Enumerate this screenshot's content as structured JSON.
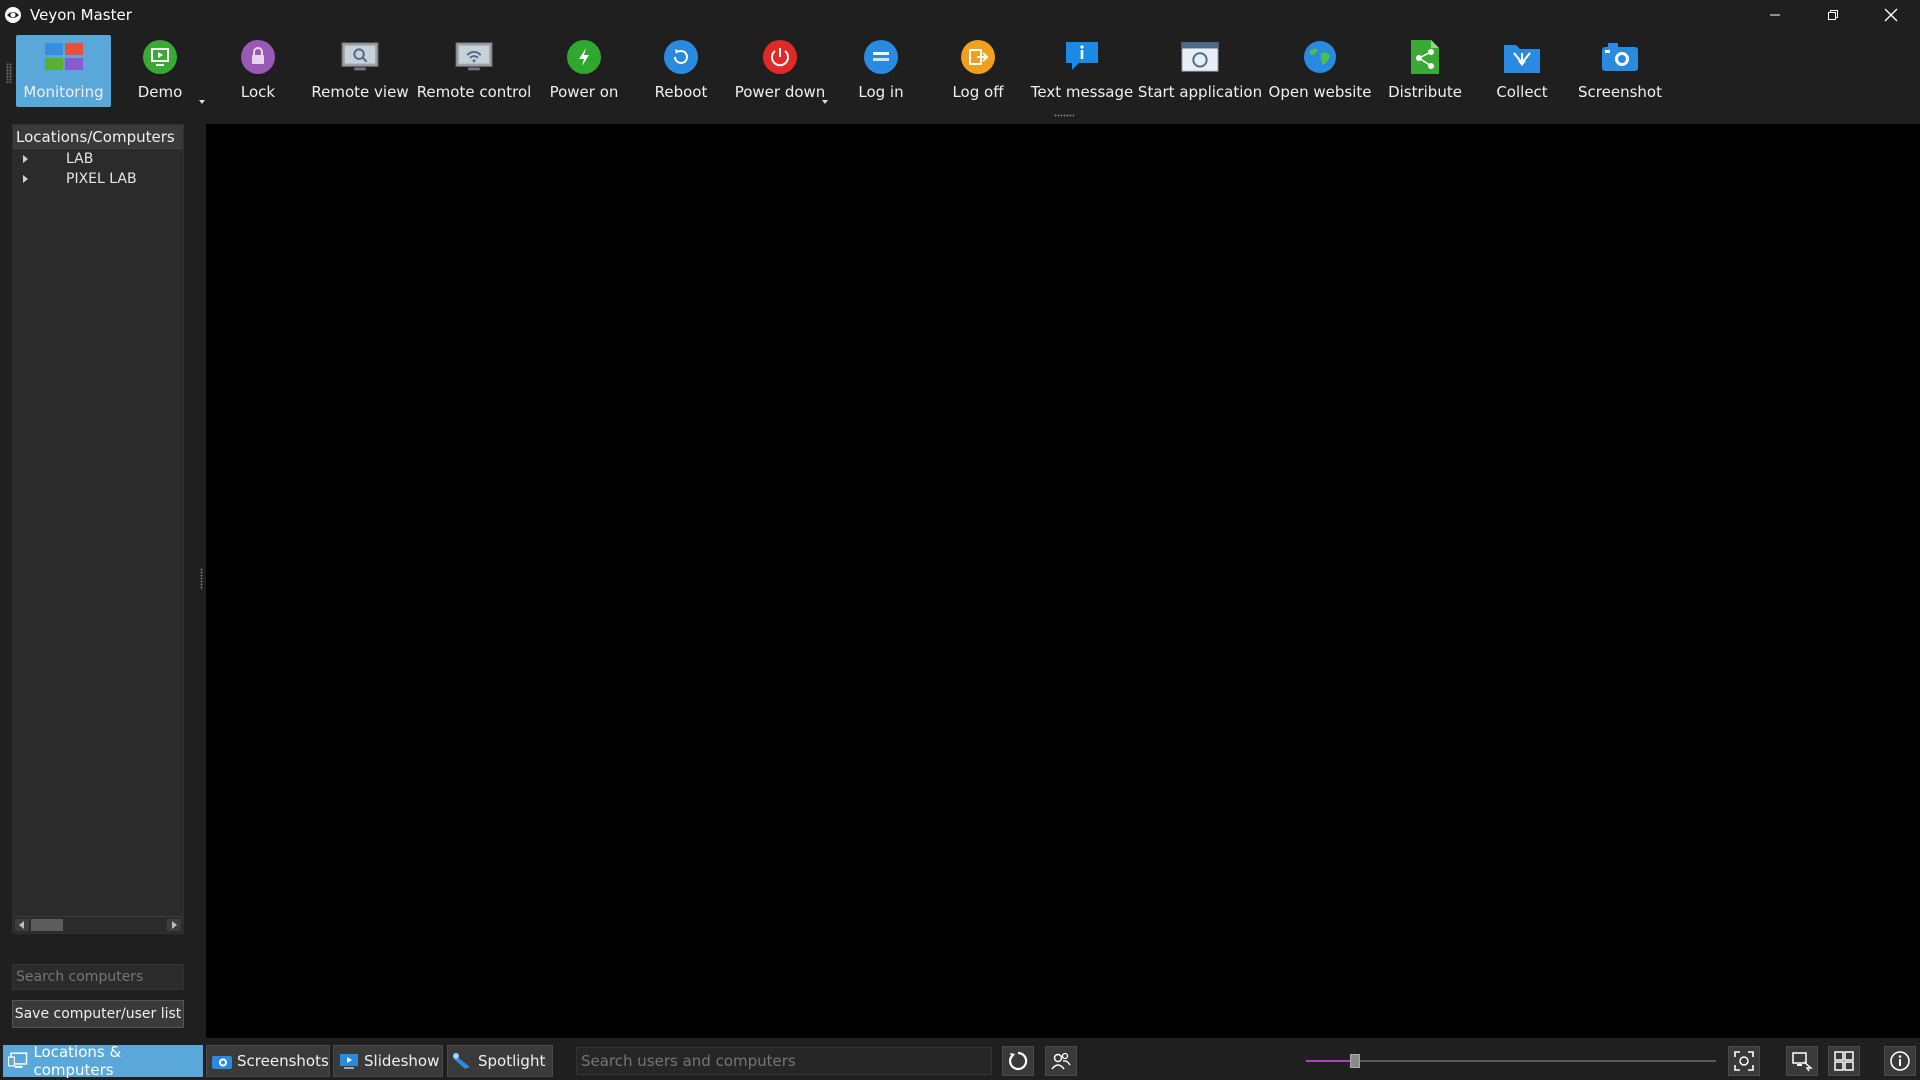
{
  "window": {
    "title": "Veyon Master"
  },
  "toolbar": {
    "buttons": [
      {
        "id": "monitoring",
        "label": "Monitoring",
        "icon": "monitoring-icon",
        "active": true
      },
      {
        "id": "demo",
        "label": "Demo",
        "icon": "demo-icon",
        "has_menu": true
      },
      {
        "id": "lock",
        "label": "Lock",
        "icon": "lock-icon"
      },
      {
        "id": "remote-view",
        "label": "Remote view",
        "icon": "remote-view-icon"
      },
      {
        "id": "remote-control",
        "label": "Remote control",
        "icon": "remote-control-icon"
      },
      {
        "id": "power-on",
        "label": "Power on",
        "icon": "power-on-icon"
      },
      {
        "id": "reboot",
        "label": "Reboot",
        "icon": "reboot-icon"
      },
      {
        "id": "power-down",
        "label": "Power down",
        "icon": "power-down-icon",
        "has_menu": true
      },
      {
        "id": "log-in",
        "label": "Log in",
        "icon": "log-in-icon"
      },
      {
        "id": "log-off",
        "label": "Log off",
        "icon": "log-off-icon"
      },
      {
        "id": "text-message",
        "label": "Text message",
        "icon": "text-message-icon"
      },
      {
        "id": "start-application",
        "label": "Start application",
        "icon": "start-application-icon"
      },
      {
        "id": "open-website",
        "label": "Open website",
        "icon": "open-website-icon"
      },
      {
        "id": "distribute",
        "label": "Distribute",
        "icon": "distribute-icon"
      },
      {
        "id": "collect",
        "label": "Collect",
        "icon": "collect-icon"
      },
      {
        "id": "screenshot",
        "label": "Screenshot",
        "icon": "screenshot-icon"
      }
    ]
  },
  "left_panel": {
    "header": "Locations/Computers",
    "items": [
      {
        "label": "LAB"
      },
      {
        "label": "PIXEL LAB"
      }
    ],
    "search_placeholder": "Search computers",
    "save_label": "Save computer/user list"
  },
  "bottom_bar": {
    "tabs": [
      {
        "label": "Locations & computers",
        "active": true,
        "icon": "locations-computers-icon"
      },
      {
        "label": "Screenshots",
        "icon": "screenshots-icon"
      },
      {
        "label": "Slideshow",
        "icon": "slideshow-icon"
      },
      {
        "label": "Spotlight",
        "icon": "spotlight-icon"
      }
    ],
    "search_placeholder": "Search users and computers",
    "zoom_level": 0.12
  },
  "colors": {
    "accent": "#5aa7da",
    "background": "#1f1f1f",
    "main": "#000000",
    "slider": "#b040c0"
  }
}
